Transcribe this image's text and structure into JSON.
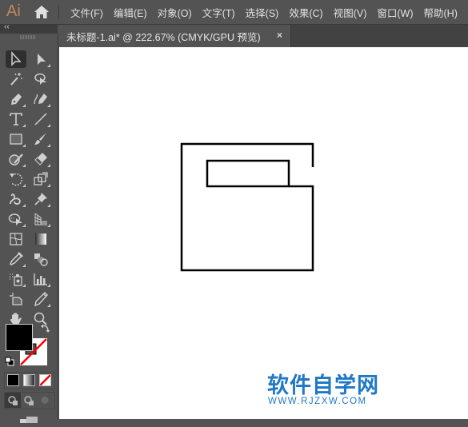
{
  "app": {
    "logo": "Ai",
    "accent_color": "#c2865a"
  },
  "menubar": {
    "items": [
      {
        "label": "文件(F)"
      },
      {
        "label": "编辑(E)"
      },
      {
        "label": "对象(O)"
      },
      {
        "label": "文字(T)"
      },
      {
        "label": "选择(S)"
      },
      {
        "label": "效果(C)"
      },
      {
        "label": "视图(V)"
      },
      {
        "label": "窗口(W)"
      },
      {
        "label": "帮助(H)"
      }
    ]
  },
  "document_tab": {
    "title": "未标题-1.ai* @ 222.67% (CMYK/GPU 预览)",
    "close": "×"
  },
  "toolbar": {
    "collapse_label": "‹‹",
    "tools": [
      {
        "name": "selection-tool",
        "active": true
      },
      {
        "name": "direct-selection-tool"
      },
      {
        "name": "magic-wand-tool"
      },
      {
        "name": "lasso-tool"
      },
      {
        "name": "pen-tool"
      },
      {
        "name": "curvature-tool"
      },
      {
        "name": "type-tool"
      },
      {
        "name": "line-segment-tool"
      },
      {
        "name": "rectangle-tool"
      },
      {
        "name": "paintbrush-tool"
      },
      {
        "name": "shaper-tool"
      },
      {
        "name": "eraser-tool"
      },
      {
        "name": "rotate-tool"
      },
      {
        "name": "scale-tool"
      },
      {
        "name": "puppet-warp-tool"
      },
      {
        "name": "pin-tool"
      },
      {
        "name": "shape-builder-tool"
      },
      {
        "name": "perspective-grid-tool"
      },
      {
        "name": "mesh-tool"
      },
      {
        "name": "gradient-tool"
      },
      {
        "name": "eyedropper-tool"
      },
      {
        "name": "blend-tool"
      },
      {
        "name": "symbol-sprayer-tool"
      },
      {
        "name": "column-graph-tool"
      },
      {
        "name": "artboard-tool"
      },
      {
        "name": "slice-tool"
      },
      {
        "name": "hand-tool"
      },
      {
        "name": "zoom-tool"
      }
    ],
    "fill_color": "#000000",
    "stroke_color": "none",
    "color_modes": [
      "color",
      "gradient",
      "none"
    ],
    "draw_modes": [
      "draw-normal",
      "draw-behind",
      "draw-inside"
    ]
  },
  "watermark": {
    "title": "软件自学网",
    "url": "WWW.RJZXW.COM",
    "color": "#1e78c8"
  }
}
